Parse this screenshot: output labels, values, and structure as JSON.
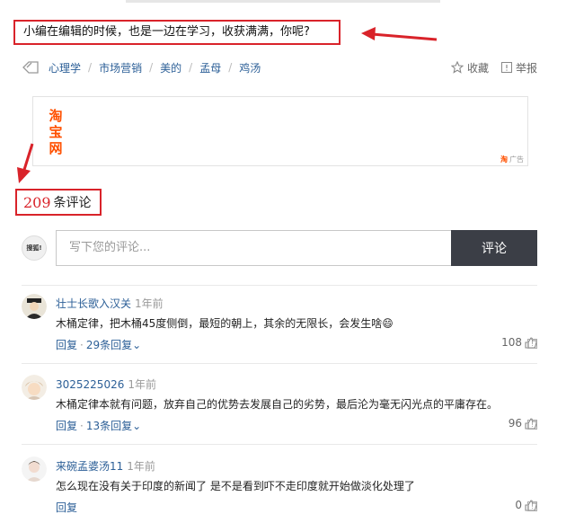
{
  "article": {
    "closing_sentence": "小编在编辑的时候，也是一边在学习，收获满满，你呢?"
  },
  "tags": [
    "心理学",
    "市场营销",
    "美的",
    "孟母",
    "鸡汤"
  ],
  "actions": {
    "favorite": "收藏",
    "report": "举报"
  },
  "ad": {
    "logo_chars": [
      "淘",
      "宝",
      "网"
    ],
    "corner_brand": "淘",
    "corner_label": "广告"
  },
  "comments_header": {
    "count": "209",
    "label": "条评论"
  },
  "composer": {
    "avatar_text": "搜狐!",
    "placeholder": "写下您的评论...",
    "submit_label": "评论"
  },
  "comments": [
    {
      "user": "壮士长歌入汉关",
      "time": "1年前",
      "text": "木桶定律，把木桶45度侧倒，最短的朝上，其余的无限长，会发生啥",
      "emoji": "😄",
      "reply": "回复",
      "replies": "29条回复",
      "likes": "108",
      "report": "!"
    },
    {
      "user": "3025225026",
      "time": "1年前",
      "text": "木桶定律本就有问题，放弃自己的优势去发展自己的劣势，最后沦为毫无闪光点的平庸存在。",
      "emoji": "",
      "reply": "回复",
      "replies": "13条回复",
      "likes": "96",
      "report": "!"
    },
    {
      "user": "来碗孟婆汤11",
      "time": "1年前",
      "text": "怎么现在没有关于印度的新闻了 是不是看到吓不走印度就开始做淡化处理了",
      "emoji": "",
      "reply": "回复",
      "replies": "",
      "likes": "0",
      "report": "!"
    }
  ],
  "colors": {
    "annotation_red": "#d9232a",
    "link_blue": "#2c5f97",
    "taobao_orange": "#ff5000",
    "submit_bg": "#3b3e46"
  }
}
